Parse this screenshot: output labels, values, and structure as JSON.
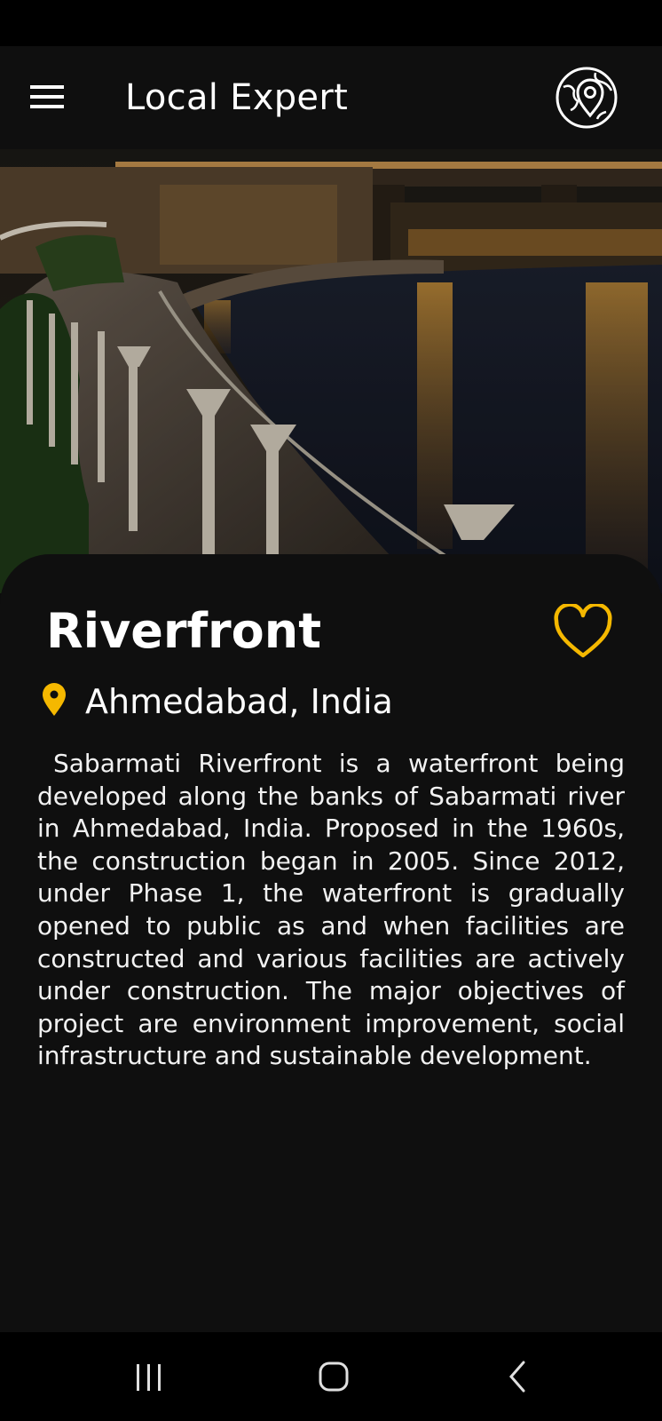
{
  "app_bar": {
    "title": "Local Expert",
    "menu_icon": "hamburger-menu-icon",
    "action_icon": "globe-location-pin-icon"
  },
  "hero": {
    "image": "night river promenade with lamp posts and bridge"
  },
  "place": {
    "name": "Riverfront",
    "location": "Ahmedabad, India",
    "location_icon": "map-pin-icon",
    "favorite_icon": "heart-outline-icon",
    "description": "Sabarmati Riverfront is a waterfront being developed along the banks of Sabarmati river in Ahmedabad, India. Proposed in the 1960s, the construction began in 2005. Since 2012, under Phase 1, the waterfront is gradually opened to public as and when facilities are constructed and various facilities are actively under construction. The major objectives of project are environment improvement, social infrastructure and sustainable development."
  },
  "nav_bar": {
    "recents_icon": "recent-apps-icon",
    "home_icon": "home-icon",
    "back_icon": "back-icon"
  },
  "colors": {
    "background": "#0d0d0d",
    "accent": "#f5b800",
    "text": "#ffffff"
  }
}
